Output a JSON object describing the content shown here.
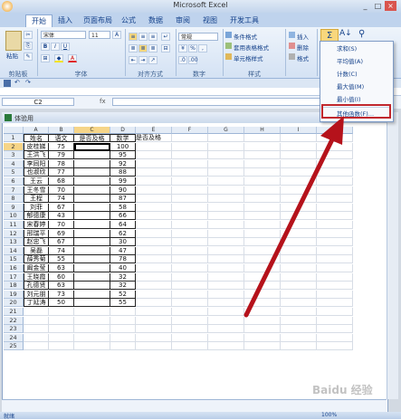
{
  "window": {
    "title": "Microsoft Excel"
  },
  "ribbon_tabs": [
    "开始",
    "插入",
    "页面布局",
    "公式",
    "数据",
    "审阅",
    "视图",
    "开发工具"
  ],
  "font": {
    "name": "宋体",
    "size": "11"
  },
  "number_format": "常规",
  "styles": {
    "conditional": "条件格式",
    "table": "套用表格格式",
    "cell": "单元格样式"
  },
  "cells_group": {
    "insert": "插入",
    "delete": "删除",
    "format": "格式"
  },
  "group_labels": {
    "clipboard": "剪贴板",
    "font": "字体",
    "align": "对齐方式",
    "number": "数字",
    "styles": "样式",
    "paste": "粘贴"
  },
  "name_box": "C2",
  "workbook_title": "体验用",
  "sum_menu": {
    "items": [
      "求和(S)",
      "平均值(A)",
      "计数(C)",
      "最大值(M)",
      "最小值(I)",
      "其他函数(F)..."
    ],
    "highlight_color": "#c0272d"
  },
  "grid": {
    "columns": [
      "A",
      "B",
      "C",
      "D",
      "E",
      "F",
      "G",
      "H",
      "I",
      "J"
    ],
    "selected_column": "C",
    "headers": [
      "姓名",
      "语文",
      "是否及格",
      "数学",
      "是否及格"
    ],
    "rows": [
      [
        "皮桂娣",
        "75",
        "",
        "100"
      ],
      [
        "王洪飞",
        "79",
        "",
        "95"
      ],
      [
        "李同阳",
        "78",
        "",
        "92"
      ],
      [
        "也淑欣",
        "77",
        "",
        "88"
      ],
      [
        "王云",
        "68",
        "",
        "99"
      ],
      [
        "王冬雪",
        "70",
        "",
        "90"
      ],
      [
        "王程",
        "74",
        "",
        "87"
      ],
      [
        "刘菲",
        "67",
        "",
        "58"
      ],
      [
        "郁德康",
        "43",
        "",
        "66"
      ],
      [
        "宋春婷",
        "70",
        "",
        "64"
      ],
      [
        "邢瑞平",
        "69",
        "",
        "62"
      ],
      [
        "赵忠飞",
        "67",
        "",
        "30"
      ],
      [
        "吴磊",
        "74",
        "",
        "47"
      ],
      [
        "薛秀菊",
        "55",
        "",
        "78"
      ],
      [
        "阚金莹",
        "63",
        "",
        "40"
      ],
      [
        "王晓霞",
        "60",
        "",
        "32"
      ],
      [
        "孔德贤",
        "63",
        "",
        "32"
      ],
      [
        "刘元朋",
        "73",
        "",
        "52"
      ],
      [
        "丁延涛",
        "50",
        "",
        "55"
      ]
    ],
    "row_numbers": [
      "1",
      "2",
      "3",
      "4",
      "5",
      "6",
      "7",
      "8",
      "9",
      "10",
      "11",
      "12",
      "13",
      "14",
      "15",
      "16",
      "17",
      "18",
      "19",
      "20",
      "21",
      "22",
      "23",
      "24",
      "25"
    ]
  },
  "status": {
    "ready": "就绪",
    "zoom": "100%"
  },
  "watermark": "Baidu 经验"
}
